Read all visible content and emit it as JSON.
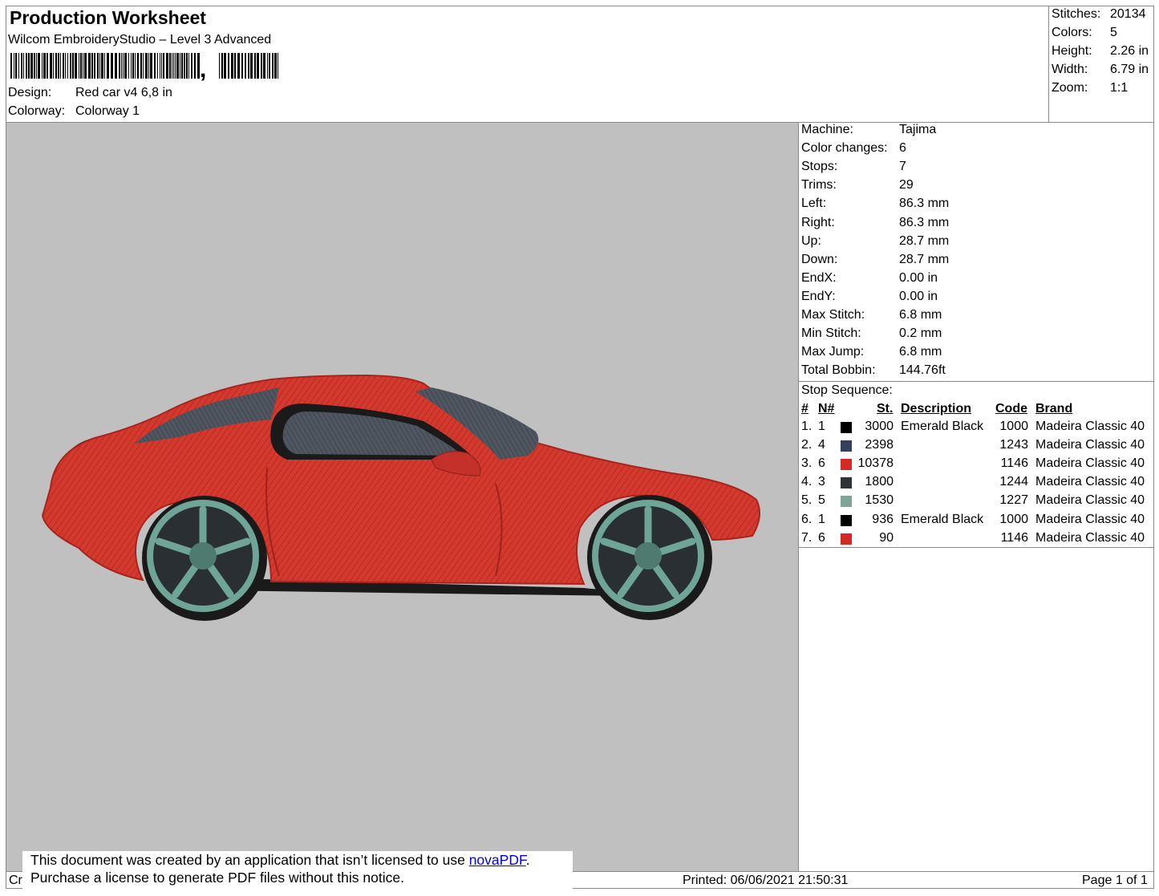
{
  "header": {
    "title": "Production Worksheet",
    "software": "Wilcom EmbroideryStudio – Level 3 Advanced",
    "barcode_comma": ",",
    "design_label": "Design:",
    "design_value": "Red car v4 6,8 in",
    "colorway_label": "Colorway:",
    "colorway_value": "Colorway 1"
  },
  "summary": {
    "stitches_label": "Stitches:",
    "stitches_value": "20134",
    "colors_label": "Colors:",
    "colors_value": "5",
    "height_label": "Height:",
    "height_value": "2.26 in",
    "width_label": "Width:",
    "width_value": "6.79 in",
    "zoom_label": "Zoom:",
    "zoom_value": "1:1"
  },
  "machine_info": [
    {
      "label": "Machine:",
      "value": "Tajima"
    },
    {
      "label": "Color changes:",
      "value": "6"
    },
    {
      "label": "Stops:",
      "value": "7"
    },
    {
      "label": "Trims:",
      "value": "29"
    },
    {
      "label": "Left:",
      "value": "86.3 mm"
    },
    {
      "label": "Right:",
      "value": "86.3 mm"
    },
    {
      "label": "Up:",
      "value": "28.7 mm"
    },
    {
      "label": "Down:",
      "value": "28.7 mm"
    },
    {
      "label": "EndX:",
      "value": "0.00 in"
    },
    {
      "label": "EndY:",
      "value": "0.00 in"
    },
    {
      "label": "Max Stitch:",
      "value": "6.8 mm"
    },
    {
      "label": "Min Stitch:",
      "value": "0.2 mm"
    },
    {
      "label": "Max Jump:",
      "value": "6.8 mm"
    },
    {
      "label": "Total Bobbin:",
      "value": "144.76ft"
    }
  ],
  "stop_sequence": {
    "title": "Stop Sequence:",
    "headers": {
      "num": "#",
      "n": "N#",
      "st": "St.",
      "description": "Description",
      "code": "Code",
      "brand": "Brand"
    },
    "rows": [
      {
        "num": "1.",
        "n": "1",
        "color": "#000000",
        "st": "3000",
        "description": "Emerald Black",
        "code": "1000",
        "brand": "Madeira Classic 40"
      },
      {
        "num": "2.",
        "n": "4",
        "color": "#35405a",
        "st": "2398",
        "description": "",
        "code": "1243",
        "brand": "Madeira Classic 40"
      },
      {
        "num": "3.",
        "n": "6",
        "color": "#d42a25",
        "st": "10378",
        "description": "",
        "code": "1146",
        "brand": "Madeira Classic 40"
      },
      {
        "num": "4.",
        "n": "3",
        "color": "#2f3238",
        "st": "1800",
        "description": "",
        "code": "1244",
        "brand": "Madeira Classic 40"
      },
      {
        "num": "5.",
        "n": "5",
        "color": "#7ea59a",
        "st": "1530",
        "description": "",
        "code": "1227",
        "brand": "Madeira Classic 40"
      },
      {
        "num": "6.",
        "n": "1",
        "color": "#000000",
        "st": "936",
        "description": "Emerald Black",
        "code": "1000",
        "brand": "Madeira Classic 40"
      },
      {
        "num": "7.",
        "n": "6",
        "color": "#d42a25",
        "st": "90",
        "description": "",
        "code": "1146",
        "brand": "Madeira Classic 40"
      }
    ]
  },
  "footer": {
    "created_partial": "Cr",
    "printed": "Printed: 06/06/2021 21:50:31",
    "page": "Page 1 of 1"
  },
  "notice": {
    "line1_prefix": "This document was created by an application that isn’t licensed to use ",
    "link": "novaPDF",
    "line1_suffix": ".",
    "line2": "Purchase a license to generate PDF files without this notice."
  }
}
